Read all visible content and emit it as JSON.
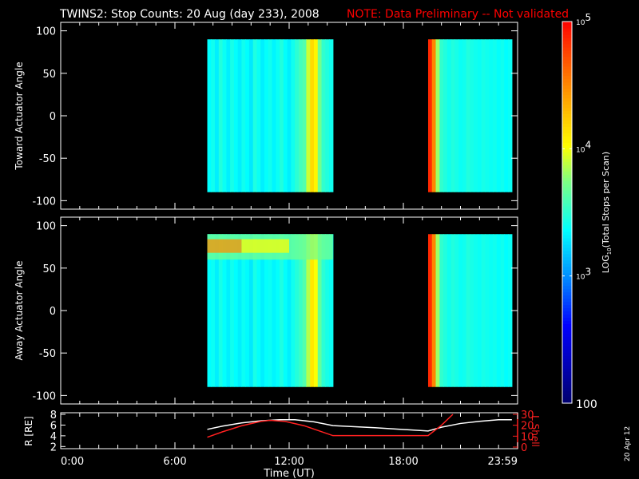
{
  "title": {
    "main": "TWINS2: Stop Counts: 20 Aug (day 233), 2008",
    "note": "NOTE: Data Preliminary -- Not validated",
    "note_color": "#ff0000"
  },
  "side_date": "20 Apr 12",
  "chart_data": [
    {
      "type": "heatmap",
      "name": "toward",
      "ylabel": "Toward Actuator Angle",
      "ylim": [
        -110,
        110
      ],
      "yticks": [
        100,
        50,
        0,
        -50,
        -100
      ],
      "angle_range": [
        -90,
        90
      ],
      "xlim": [
        0,
        24
      ],
      "blocks": [
        {
          "t_start": 7.7,
          "t_end": 14.3,
          "columns": [
            3.35,
            3.4,
            3.3,
            3.45,
            3.38,
            3.3,
            3.42,
            3.36,
            3.3,
            3.4,
            3.35,
            3.28,
            3.44,
            3.38,
            3.3,
            3.36,
            3.4,
            3.32,
            3.38,
            3.45,
            3.36,
            3.3,
            3.4,
            3.48,
            3.55,
            3.6,
            3.9,
            4.15,
            4.05,
            3.7,
            3.5,
            3.45,
            3.4
          ]
        },
        {
          "t_start": 19.3,
          "t_end": 23.7,
          "columns": [
            4.85,
            4.5,
            3.8,
            3.5,
            3.45,
            3.4,
            3.45,
            3.42,
            3.38,
            3.4,
            3.45,
            3.42,
            3.4,
            3.38,
            3.42,
            3.4,
            3.38,
            3.4,
            3.36,
            3.4,
            3.35,
            3.38
          ]
        }
      ],
      "enhancements": []
    },
    {
      "type": "heatmap",
      "name": "away",
      "ylabel": "Away Actuator Angle",
      "ylim": [
        -110,
        110
      ],
      "yticks": [
        100,
        50,
        0,
        -50,
        -100
      ],
      "angle_range": [
        -90,
        90
      ],
      "xlim": [
        0,
        24
      ],
      "blocks": [
        {
          "t_start": 7.7,
          "t_end": 14.3,
          "columns": [
            3.35,
            3.38,
            3.3,
            3.42,
            3.36,
            3.3,
            3.4,
            3.35,
            3.3,
            3.38,
            3.34,
            3.28,
            3.42,
            3.36,
            3.3,
            3.36,
            3.38,
            3.32,
            3.36,
            3.44,
            3.36,
            3.3,
            3.4,
            3.46,
            3.52,
            3.6,
            3.85,
            4.1,
            4.0,
            3.65,
            3.48,
            3.42,
            3.38
          ]
        },
        {
          "t_start": 19.3,
          "t_end": 23.7,
          "columns": [
            4.85,
            4.5,
            3.8,
            3.5,
            3.45,
            3.4,
            3.45,
            3.42,
            3.38,
            3.4,
            3.45,
            3.42,
            3.4,
            3.38,
            3.42,
            3.4,
            3.38,
            3.4,
            3.36,
            3.4,
            3.35,
            3.38
          ]
        }
      ],
      "enhancements": [
        {
          "t_start": 7.7,
          "t_end": 9.5,
          "a_min": 68,
          "a_max": 84,
          "value": 4.45
        },
        {
          "t_start": 9.5,
          "t_end": 12.0,
          "a_min": 68,
          "a_max": 84,
          "value": 4.0
        },
        {
          "t_start": 7.7,
          "t_end": 14.3,
          "a_min": 60,
          "a_max": 90,
          "value": 3.7
        }
      ]
    },
    {
      "type": "line",
      "name": "orbit",
      "xlabel": "Time (UT)",
      "xticks": [
        "0:00",
        "6:00",
        "12:00",
        "18:00",
        "23:59"
      ],
      "xtick_values": [
        0,
        6,
        12,
        18,
        24
      ],
      "ylabel_left": "R [RE]",
      "ylim_left": [
        1.6,
        8.3
      ],
      "yticks_left": [
        8,
        6,
        4,
        2
      ],
      "ylabel_right": "L Shell",
      "ylim_right": [
        0,
        30
      ],
      "yticks_right": [
        30,
        20,
        10,
        0
      ],
      "series": [
        {
          "name": "R",
          "color": "#ffffff",
          "axis": "left",
          "x": [
            7.7,
            8.5,
            9.5,
            10.5,
            11.5,
            12.3,
            13.3,
            14.3,
            16.5,
            19.3,
            20.0,
            21.0,
            22.0,
            23.0,
            23.7
          ],
          "y": [
            5.2,
            5.8,
            6.4,
            6.8,
            7.0,
            7.0,
            6.6,
            5.9,
            5.5,
            4.9,
            5.6,
            6.3,
            6.7,
            7.0,
            7.0
          ]
        },
        {
          "name": "L Shell",
          "color": "#ff2020",
          "axis": "right",
          "x": [
            7.7,
            8.5,
            9.5,
            10.5,
            11.0,
            11.8,
            12.8,
            14.3,
            19.3,
            20.0,
            20.6
          ],
          "y": [
            9,
            14,
            19.5,
            23.5,
            24.5,
            23.5,
            19.5,
            10.5,
            10.5,
            20,
            30
          ]
        }
      ]
    }
  ],
  "colorbar": {
    "label": "LOG10(Total Stops per Scan)",
    "label_main": "LOG",
    "label_sub": "10",
    "label_rest": "(Total Stops per Scan)",
    "range_log": [
      2,
      5
    ],
    "ticks": [
      {
        "value": 5,
        "base": "10",
        "exp": "5"
      },
      {
        "value": 4,
        "base": "10",
        "exp": "4"
      },
      {
        "value": 3,
        "base": "10",
        "exp": "3"
      },
      {
        "value": 2,
        "base": "100",
        "exp": ""
      }
    ]
  }
}
